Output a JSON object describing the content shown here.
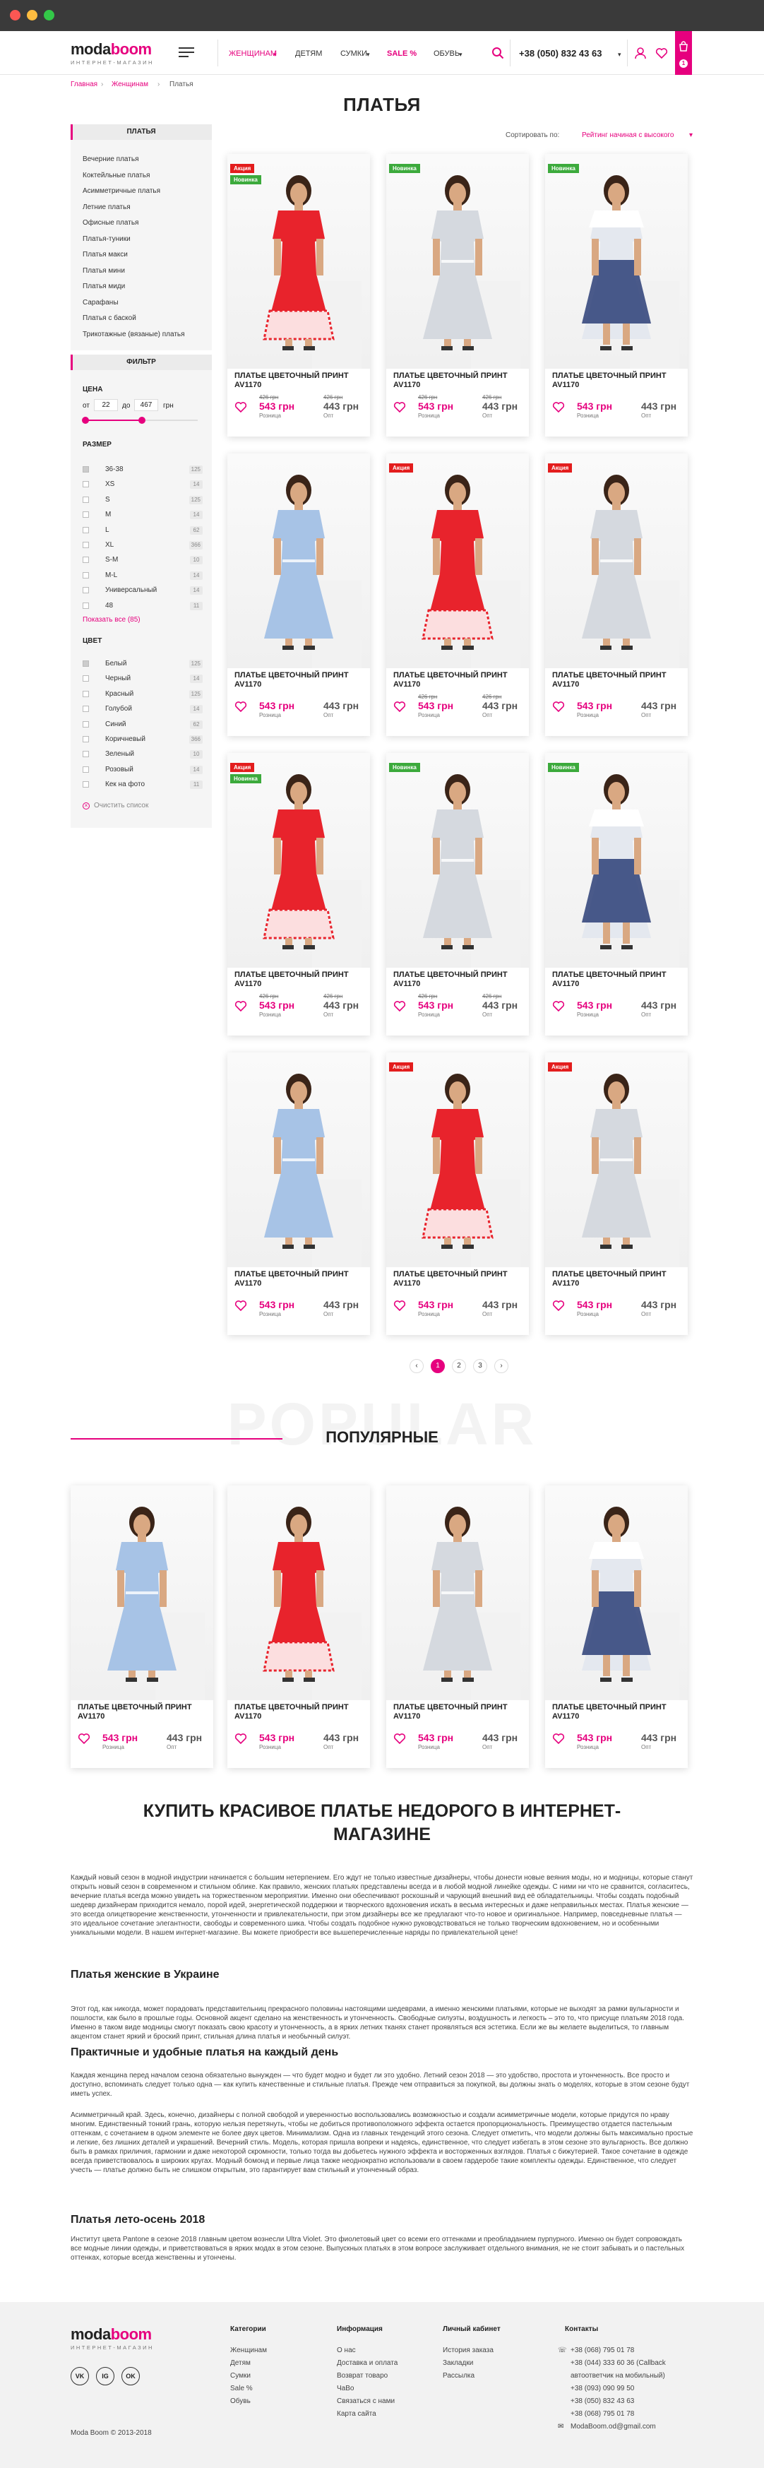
{
  "header": {
    "logo_a": "moda",
    "logo_b": "boom",
    "logo_sub": "интернет-магазин",
    "nav": [
      "ЖЕНЩИНАМ",
      "ДЕТЯМ",
      "СУМКИ",
      "SALE %",
      "ОБУВЬ"
    ],
    "phone": "+38 (050) 832 43 63",
    "cart_count": "1"
  },
  "breadcrumb": [
    "Главная",
    "Женщинам",
    "Платья"
  ],
  "page_title": "ПЛАТЬЯ",
  "sort": {
    "label": "Сортировать по:",
    "value": "Рейтинг начиная с высокого"
  },
  "sidebar": {
    "dresses_head": "ПЛАТЬЯ",
    "categories": [
      "Вечерние платья",
      "Коктейльные платья",
      "Асимметричные платья",
      "Летние платья",
      "Офисные платья",
      "Платья-туники",
      "Платья макси",
      "Платья мини",
      "Платья миди",
      "Сарафаны",
      "Платья с баской",
      "Трикотажные (вязаные) платья"
    ],
    "filter_head": "ФИЛЬТР",
    "price_label": "ЦЕНА",
    "price_from_label": "от",
    "price_from": "22",
    "price_to_label": "до",
    "price_to": "467",
    "price_unit": "грн",
    "size_label": "РАЗМЕР",
    "sizes": [
      [
        "36-38",
        "125"
      ],
      [
        "XS",
        "14"
      ],
      [
        "S",
        "125"
      ],
      [
        "M",
        "14"
      ],
      [
        "L",
        "62"
      ],
      [
        "XL",
        "366"
      ],
      [
        "S-M",
        "10"
      ],
      [
        "M-L",
        "14"
      ],
      [
        "Универсальный",
        "14"
      ],
      [
        "48",
        "11"
      ]
    ],
    "show_all": "Показать все (85)",
    "color_label": "ЦВЕТ",
    "colors": [
      [
        "Белый",
        "125"
      ],
      [
        "Черный",
        "14"
      ],
      [
        "Красный",
        "125"
      ],
      [
        "Голубой",
        "14"
      ],
      [
        "Синий",
        "62"
      ],
      [
        "Коричневый",
        "366"
      ],
      [
        "Зеленый",
        "10"
      ],
      [
        "Розовый",
        "14"
      ],
      [
        "Кек на фото",
        "11"
      ]
    ],
    "clear": "Очистить список"
  },
  "product": {
    "name": "ПЛАТЬЕ ЦВЕТОЧНЫЙ ПРИНТ AV1170",
    "old_price": "426 грн",
    "price_retail": "543 грн",
    "price_wholesale": "443 грн",
    "retail_label": "Розница",
    "wholesale_label": "Опт",
    "badge_sale": "Акция",
    "badge_new": "Новинка"
  },
  "pagination": [
    "1",
    "2",
    "3"
  ],
  "popular": {
    "bg_word": "POPULAR",
    "title": "ПОПУЛЯРНЫЕ"
  },
  "seo": {
    "title": "КУПИТЬ КРАСИВОЕ ПЛАТЬЕ НЕДОРОГО В ИНТЕРНЕТ-МАГАЗИНЕ",
    "p1": "Каждый новый сезон в модной индустрии начинается с большим нетерпением. Его ждут не только известные дизайнеры, чтобы донести новые веяния моды, но и модницы, которые станут открыть новый сезон в современном и стильном облике. Как правило, женских платьях представлены всегда и в любой модной линейке одежды. С ними ни что не сравнится, согласитесь, вечерние платья всегда можно увидеть на торжественном мероприятии. Именно они обеспечивают роскошный и чарующий внешний вид её обладательницы. Чтобы создать подобный шедевр дизайнерам приходится немало, порой идей, энергетической поддержки и творческого вдохновения искать в весьма интересных и даже неправильных местах. Платья женские — это всегда олицетворение женственности, утонченности и привлекательности, при этом дизайнеры все же предлагают что-то новое и оригинальное. Например, повседневные платья — это идеальное сочетание элегантности, свободы и современного шика. Чтобы создать подобное нужно руководствоваться не только творческим вдохновением, но и особенными уникальными модели. В нашем интернет-магазине. Вы можете приобрести все вышеперечисленные наряды по привлекательной цене!",
    "h2": "Платья женские в Украине",
    "p2": "Этот год, как никогда, может порадовать представительниц прекрасного половины настоящими шедеврами, а именно женскими платьями, которые не выходят за рамки вульгарности и пошлости, как было в прошлые годы. Основной акцент сделано на женственность и утонченность. Свободные силуэты, воздушность и легкость – это то, что присуще платьям 2018 года. Именно в таком виде модницы смогут показать свою красоту и утонченность, а в ярких летних тканях станет проявляться вся эстетика. Если же вы желаете выделиться, то главным акцентом станет яркий и броский принт, стильная длина платья и необычный силуэт.",
    "h3": "Практичные и удобные платья на каждый день",
    "p3": "Каждая женщина перед началом сезона обязательно вынужден — что будет модно и будет ли это удобно. Летний сезон 2018 — это удобство, простота и утонченность. Все просто и доступно, вспоминать следует только одна — как купить качественные и стильные платья. Прежде чем отправиться за покупкой, вы должны знать о моделях, которые в этом сезоне будут иметь успех.",
    "p4": "Асимметричный край. Здесь, конечно, дизайнеры с полной свободой и уверенностью воспользовались возможностью и создали асимметричные модели, которые придутся по нраву многим. Единственный тонкий грань, которую нельзя перетянуть, чтобы не добиться противоположного эффекта остается пропорциональность. Преимущество отдается пастельным оттенкам, с сочетанием в одном элементе не более двух цветов. Минимализм. Одна из главных тенденций этого сезона. Следует отметить, что модели должны быть максимально простые и легкие, без лишних деталей и украшений. Вечерний стиль. Модель, которая пришла вопреки и надеясь, единственное, что следует избегать в этом сезоне это вульгарность. Все должно быть в рамках приличия, гармонии и даже некоторой скромности, только тогда вы добьетесь нужного эффекта и восторженных взглядов. Платья с бижутерией. Такое сочетание в одежде всегда приветствовалось в широких кругах. Модный бомонд и первые лица также неоднократно использовали в своем гардеробе такие комплекты одежды. Единственное, что следует учесть — платье должно быть не слишком открытым, это гарантирует вам стильный и утонченный образ.",
    "h4": "Платья лето-осень 2018",
    "p5": "Институт цвета Pantone в сезоне 2018 главным цветом вознесли Ultra Violet. Это фиолетовый цвет со всеми его оттенками и преобладанием пурпурного. Именно он будет сопровождать все модные линии одежды, и приветствоваться в ярких модах в этом сезоне. Выпускных платьях в этом вопросе заслуживает отдельного внимания, не не стоит забывать и о пастельных оттенках, которые всегда женственны и утончены."
  },
  "footer": {
    "logo_a": "moda",
    "logo_b": "boom",
    "logo_sub": "интернет-магазин",
    "copyright": "Moda Boom © 2013-2018",
    "social": [
      "VK",
      "IG",
      "OK"
    ],
    "col1_title": "Категории",
    "col1": [
      "Женщинам",
      "Детям",
      "Сумки",
      "Sale %",
      "Обувь"
    ],
    "col2_title": "Информация",
    "col2": [
      "О нас",
      "Доставка и оплата",
      "Возврат товаро",
      "ЧаВо",
      "Связаться с нами",
      "Карта сайта"
    ],
    "col3_title": "Личный кабинет",
    "col3": [
      "История заказа",
      "Закладки",
      "Рассылка"
    ],
    "col4_title": "Контакты",
    "contacts": [
      "+38 (068) 795 01 78",
      "+38 (044) 333 60 36 (Callback",
      "автоответчик на мобильный)",
      "+38 (093) 090 99 50",
      "+38 (050) 832 43 63",
      "+38 (068) 795 01 78",
      "ModaBoom.od@gmail.com"
    ]
  },
  "colors": {
    "accent": "#e6007e",
    "sale": "#e31d1d",
    "new": "#3caa3c",
    "dress_red": "#e8232c",
    "dress_blue": "#a7c3e6",
    "dress_grey": "#d5d9df",
    "dress_navy_print": "#2b3e77"
  }
}
